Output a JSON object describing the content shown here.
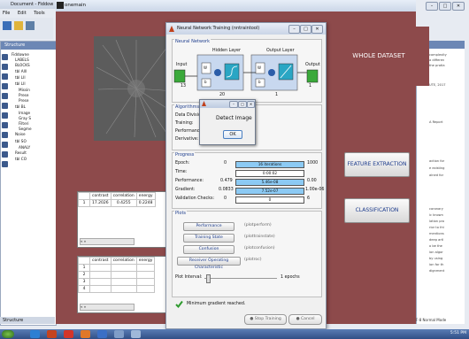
{
  "doc_window": {
    "title": "Document - Fiddow",
    "menu": [
      "File",
      "Edit",
      "Tools"
    ],
    "structure_header": "Structure",
    "structure_footer": "Structure",
    "tree": [
      "Fiddowne",
      "LABELS",
      "BLOCKS",
      "tbl Alll",
      "tbl LII",
      "tbl LII",
      "Missin",
      "Prese",
      "Prese",
      "tbl BL",
      "Image",
      "Gray S",
      "Filteri",
      "Segme",
      "Noise",
      "tbl SO",
      "ANALY",
      "Result",
      "tbl CO"
    ],
    "right_snippets": [
      "complexity",
      "a differen",
      "the protla",
      "UTE, 2017",
      "A Report",
      "action for",
      "e existing",
      "ained for",
      "coronary",
      "ic known",
      "lation pro",
      "rior to thi",
      "mentions",
      "deep artl",
      "o be the",
      "ion algor",
      "by using",
      "ion for th",
      "dignment"
    ],
    "status_right": "F-8  Normal Mode"
  },
  "main_window": {
    "title": "onemain",
    "whole_dataset_label": "WHOLE DATASET",
    "feature_extraction_label": "FEATURE EXTRACTION",
    "classification_label": "CLASSIFICATION",
    "table1": {
      "headers": [
        "",
        "contrast",
        "correlation",
        "energy"
      ],
      "rows": [
        [
          "1",
          "17.2026",
          "0.4255",
          "0.2248"
        ]
      ]
    },
    "table2": {
      "headers": [
        "",
        "contrast",
        "correlation",
        "energy"
      ],
      "rows": [
        [
          "1",
          "",
          "",
          ""
        ],
        [
          "2",
          "",
          "",
          ""
        ],
        [
          "3",
          "",
          "",
          ""
        ],
        [
          "4",
          "",
          "",
          ""
        ]
      ]
    },
    "scroll_label": "«  »"
  },
  "nntraintool": {
    "title": "Neural Network Training (nntraintool)",
    "neural_network_header": "Neural Network",
    "hidden_layer": "Hidden Layer",
    "output_layer": "Output Layer",
    "input_label": "Input",
    "output_label": "Output",
    "input_size": "13",
    "hidden_size": "20",
    "output_layer_size": "1",
    "output_size": "1",
    "w_label": "W",
    "b_label": "b",
    "algorithms_header": "Algorithms",
    "algorithms": [
      {
        "key": "Data Division:",
        "value": "Ran"
      },
      {
        "key": "Training:",
        "value": "Scal"
      },
      {
        "key": "Performance:",
        "value": "Mea"
      },
      {
        "key": "Derivative:",
        "value": "Def"
      }
    ],
    "progress_header": "Progress",
    "progress": [
      {
        "key": "Epoch:",
        "start": "0",
        "bar": "16 iterations",
        "end": "1000",
        "fill": 1.0
      },
      {
        "key": "Time:",
        "start": "",
        "bar": "0:00:02",
        "end": "",
        "fill": 0.0
      },
      {
        "key": "Performance:",
        "start": "0.479",
        "bar": "5.46e-08",
        "end": "0.00",
        "fill": 1.0
      },
      {
        "key": "Gradient:",
        "start": "0.0833",
        "bar": "7.52e-07",
        "end": "1.00e-06",
        "fill": 1.0
      },
      {
        "key": "Validation Checks:",
        "start": "0",
        "bar": "0",
        "end": "6",
        "fill": 0.0
      }
    ],
    "plots_header": "Plots",
    "plots": [
      {
        "label": "Performance",
        "fn": "(plotperform)"
      },
      {
        "label": "Training State",
        "fn": "(plottrainstate)"
      },
      {
        "label": "Confusion",
        "fn": "(plotconfusion)"
      },
      {
        "label": "Receiver Operating Characteristic",
        "fn": "(plotroc)"
      }
    ],
    "plot_interval_label": "Plot Interval:",
    "plot_interval_value": "1 epochs",
    "status_message": "Minimum gradient reached.",
    "stop_training": "Stop Training",
    "cancel": "Cancel"
  },
  "dialog": {
    "message": "Detect Image",
    "ok_label": "OK"
  },
  "taskbar": {
    "clock": "5:51 PM"
  }
}
